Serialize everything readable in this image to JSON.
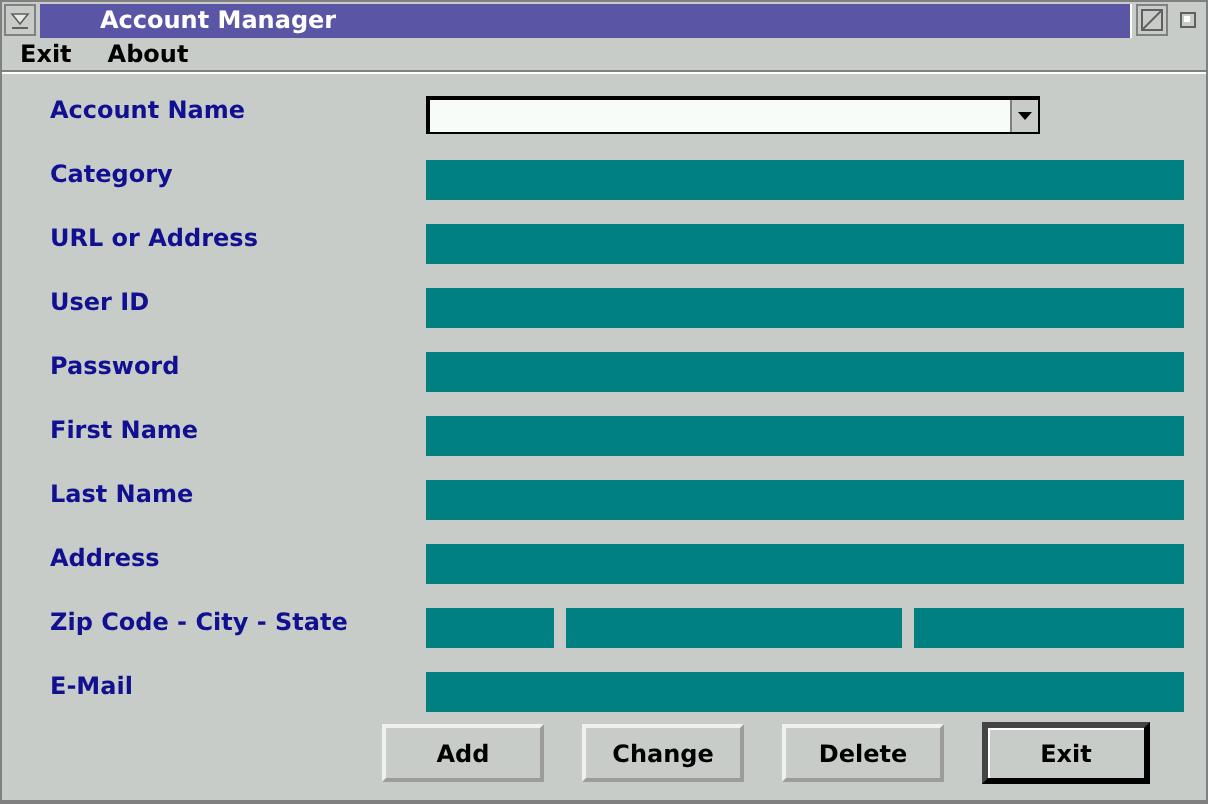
{
  "window": {
    "title": "Account Manager"
  },
  "menu": [
    {
      "label": "Exit"
    },
    {
      "label": "About"
    }
  ],
  "form": [
    {
      "label": "Account Name",
      "kind": "combo"
    },
    {
      "label": "Category",
      "kind": "text"
    },
    {
      "label": "URL or Address",
      "kind": "text"
    },
    {
      "label": "User ID",
      "kind": "text"
    },
    {
      "label": "Password",
      "kind": "text"
    },
    {
      "label": "First Name",
      "kind": "text"
    },
    {
      "label": "Last Name",
      "kind": "text"
    },
    {
      "label": "Address",
      "kind": "text"
    },
    {
      "label": "Zip Code - City - State",
      "kind": "split"
    },
    {
      "label": "E-Mail",
      "kind": "text"
    }
  ],
  "buttons": [
    {
      "label": "Add",
      "default": false
    },
    {
      "label": "Change",
      "default": false
    },
    {
      "label": "Delete",
      "default": false
    },
    {
      "label": "Exit",
      "default": true
    }
  ]
}
